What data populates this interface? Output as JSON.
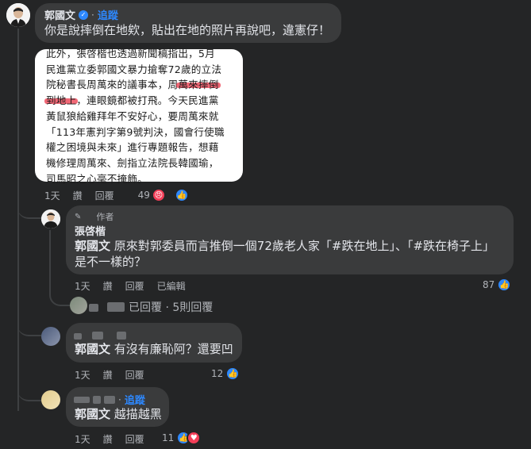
{
  "colors": {
    "background": "#242526",
    "bubble": "#3a3b3c",
    "accent": "#2d88ff",
    "highlight": "#eb283c"
  },
  "comment1": {
    "author": "郭國文",
    "verified_icon": "verified-badge-icon",
    "separator": "·",
    "follow": "追蹤",
    "text": "你是說摔倒在地欸，貼出在地的照片再說吧，違憲仔！",
    "image_lines": [
      "此外，張啓楷也透過新聞稿指出，5月",
      "民進黨立委郭國文暴力搶奪72歲的立法",
      "院秘書長周萬來的議事本，周萬來摔倒",
      "到地上，連眼鏡都被打飛。今天民進黨",
      "黃鼠狼給雞拜年不安好心，要周萬來就",
      "「113年憲判字第9號判決，國會行使職",
      "權之困境與未來」進行專題報告，想藉",
      "機修理周萬來、劍指立法院長韓國瑜，",
      "司馬昭之心毫不掩飾。"
    ],
    "image_hl_a_pre": "院秘書長周萬來的議事本，周",
    "image_hl_a": "萬來摔倒",
    "image_hl_b": "到地上",
    "image_hl_b_post": "，連眼鏡都被打飛。今天民進黨",
    "time": "1天",
    "like": "讚",
    "reply": "回覆",
    "reaction_count": "49"
  },
  "comment2": {
    "author_tag": "作者",
    "author": "張啓楷",
    "mention": "郭國文",
    "text_line1": "原來對郭委員而言推倒一個72歲老人家「#跌在地上」、「#跌在椅子上」",
    "text_line2": "是不一樣的？",
    "time": "1天",
    "like": "讚",
    "reply": "回覆",
    "edited": "已編輯",
    "reaction_count": "87"
  },
  "replies_summary": {
    "text": "已回覆 · 5則回覆"
  },
  "comment3": {
    "mention": "郭國文",
    "text": "有沒有廉恥阿？還要凹",
    "time": "1天",
    "like": "讚",
    "reply": "回覆",
    "reaction_count": "12"
  },
  "comment4": {
    "separator": "·",
    "follow": "追蹤",
    "mention": "郭國文",
    "text": "越描越黑",
    "time": "1天",
    "like": "讚",
    "reply": "回覆",
    "reaction_count": "11"
  }
}
